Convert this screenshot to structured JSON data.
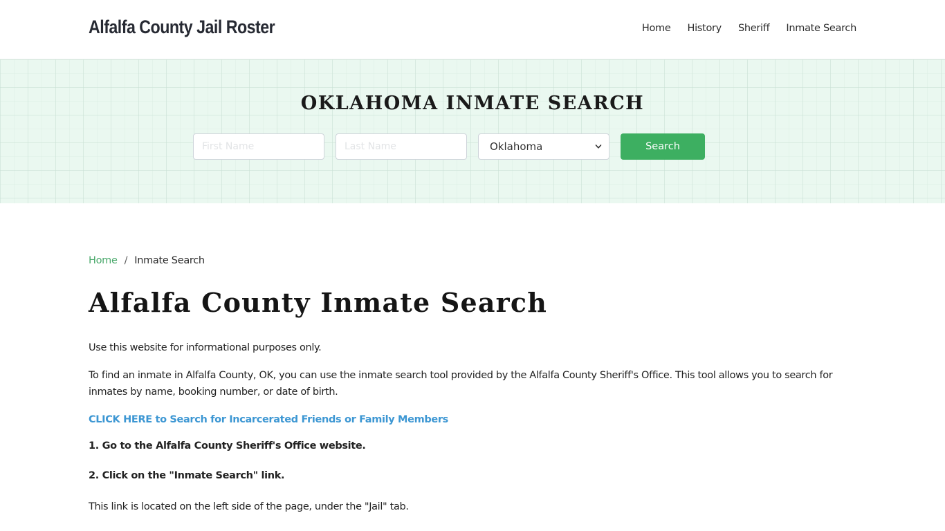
{
  "header": {
    "brand": "Alfalfa County Jail Roster",
    "nav": [
      {
        "label": "Home"
      },
      {
        "label": "History"
      },
      {
        "label": "Sheriff"
      },
      {
        "label": "Inmate Search"
      }
    ]
  },
  "hero": {
    "title": "OKLAHOMA INMATE SEARCH",
    "first_name_placeholder": "First Name",
    "first_name_value": "",
    "last_name_placeholder": "Last Name",
    "last_name_value": "",
    "state_selected": "Oklahoma",
    "search_label": "Search",
    "colors": {
      "background": "#eaf8f0",
      "button": "#3daf61"
    }
  },
  "breadcrumb": {
    "home": "Home",
    "separator": "/",
    "current": "Inmate Search"
  },
  "main": {
    "title": "Alfalfa County Inmate Search",
    "para1": "Use this website for informational purposes only.",
    "para2": "To find an inmate in Alfalfa County, OK, you can use the inmate search tool provided by the Alfalfa County Sheriff's Office. This tool allows you to search for inmates by name, booking number, or date of birth.",
    "cta_link": "CLICK HERE to Search for Incarcerated Friends or Family Members",
    "step1": "1. Go to the Alfalfa County Sheriff's Office website.",
    "step2": "2. Click on the \"Inmate Search\" link.",
    "para3": "This link is located on the left side of the page, under the \"Jail\" tab.",
    "colors": {
      "link": "#3d97d3",
      "breadcrumb_link": "#48a86a"
    }
  }
}
